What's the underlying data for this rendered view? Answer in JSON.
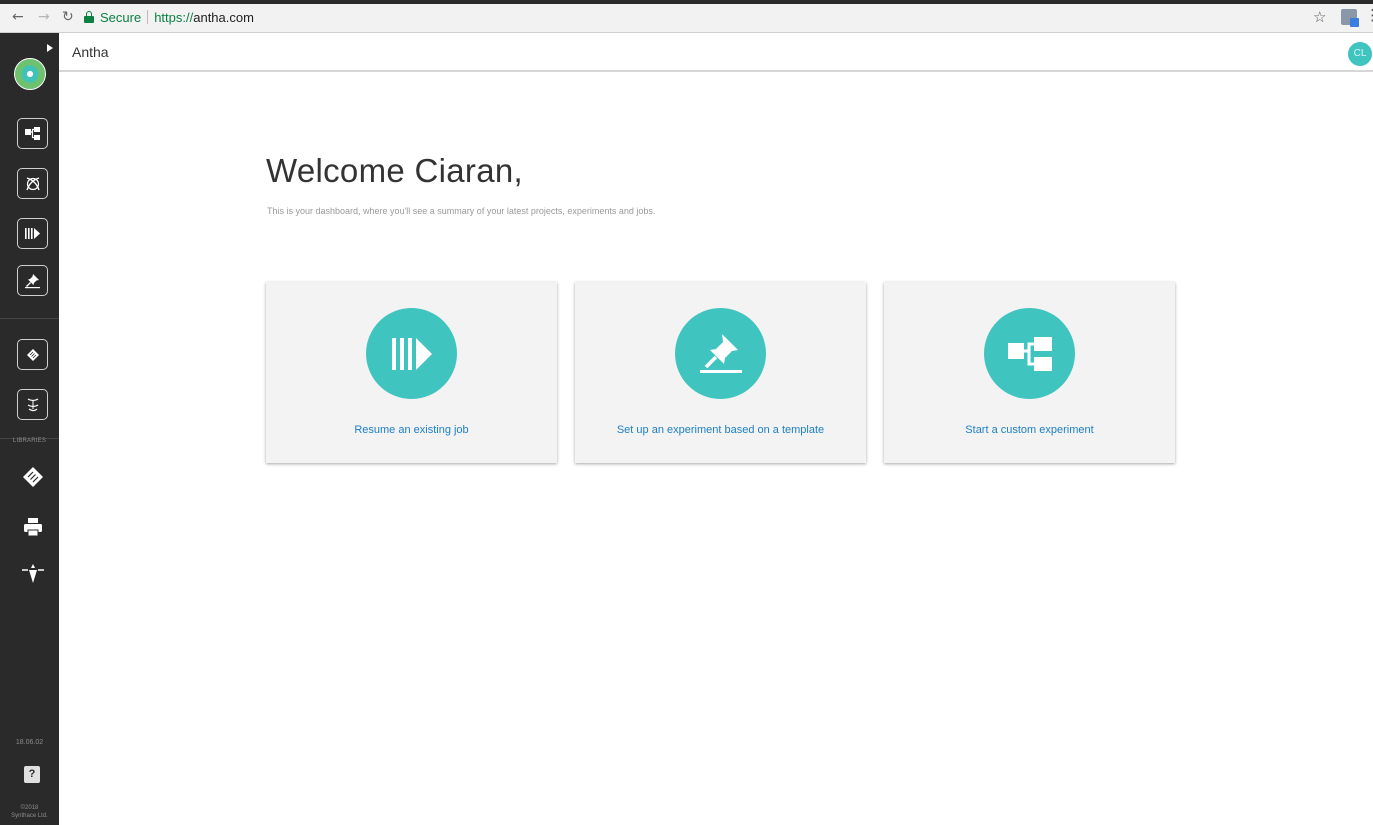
{
  "browser": {
    "secure_label": "Secure",
    "url_scheme": "https://",
    "url_host": "antha.com"
  },
  "header": {
    "app_title": "Antha",
    "avatar_initials": "CL"
  },
  "sidebar": {
    "section_label": "LIBRARIES",
    "version": "18.06.02",
    "copyright_line1": "©2018",
    "copyright_line2": "Synthace Ltd.",
    "top_icons": [
      "workflow-icon",
      "element-icon",
      "job-icon",
      "template-pin-icon"
    ],
    "mid_icons": [
      "plate-icon",
      "liquid-icon"
    ],
    "library_icons": [
      "plate-library-icon",
      "device-library-icon",
      "pipette-library-icon"
    ]
  },
  "main": {
    "welcome": "Welcome Ciaran,",
    "subtitle": "This is your dashboard, where you'll see a summary of your latest projects, experiments and jobs.",
    "cards": [
      {
        "label": "Resume an existing job",
        "icon": "job-icon"
      },
      {
        "label": "Set up an experiment based on a template",
        "icon": "pin-icon"
      },
      {
        "label": "Start a custom experiment",
        "icon": "workflow-icon"
      }
    ]
  },
  "colors": {
    "accent": "#3fc4c0",
    "link": "#1d7fc6",
    "sidebar_bg": "#2a2a2a",
    "secure_green": "#0b8043"
  }
}
